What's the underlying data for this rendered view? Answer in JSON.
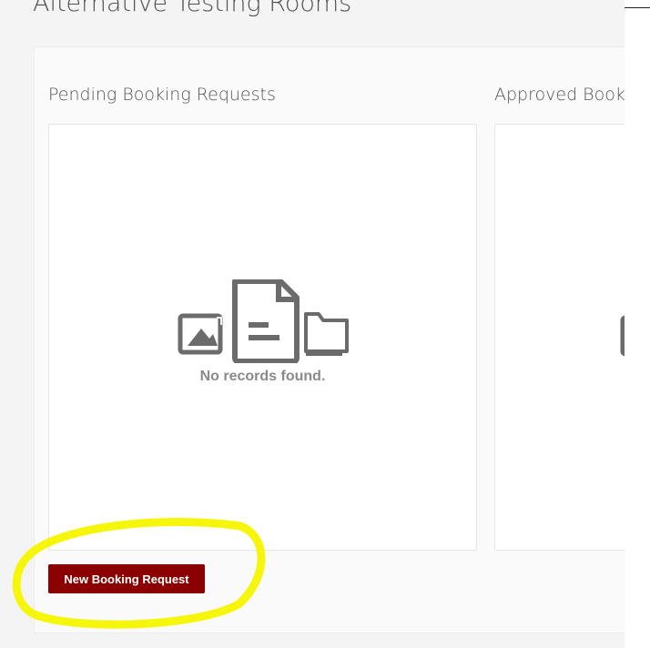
{
  "page": {
    "title": "Alternative Testing Rooms"
  },
  "pending": {
    "heading": "Pending Booking Requests",
    "empty_message": "No records found.",
    "new_button_label": "New Booking Request"
  },
  "approved": {
    "heading": "Approved Book"
  },
  "icons": {
    "empty_state": [
      "image-icon",
      "document-icon",
      "folder-icon"
    ]
  },
  "colors": {
    "primary_button": "#8b0000",
    "annotation_highlight": "#f5f500",
    "empty_icon": "#6b6b6b"
  }
}
